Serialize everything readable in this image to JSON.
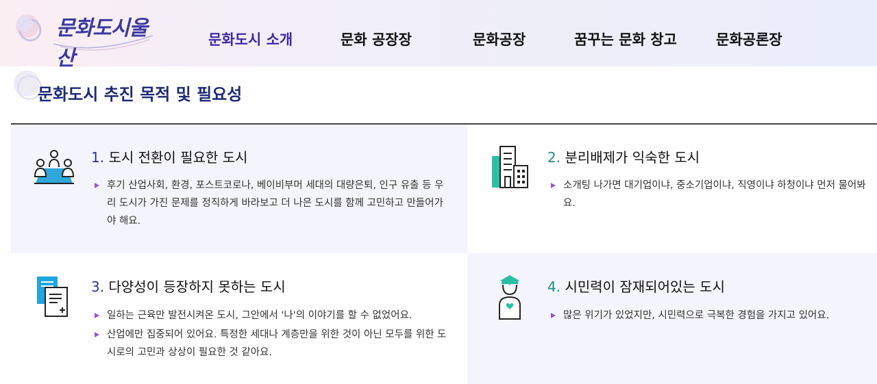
{
  "brand": {
    "logo_text": "문화도시울산"
  },
  "nav": {
    "items": [
      {
        "label": "문화도시 소개",
        "active": true
      },
      {
        "label": "문화 공장장",
        "active": false
      },
      {
        "label": "문화공장",
        "active": false
      },
      {
        "label": "꿈꾸는 문화 창고",
        "active": false
      },
      {
        "label": "문화공론장",
        "active": false
      }
    ]
  },
  "section": {
    "title": "문화도시 추진 목적 및 필요성"
  },
  "cards": [
    {
      "num": "1.",
      "title": "도시 전환이 필요한 도시",
      "icon": "meeting-people-icon",
      "bullets": [
        "후기 산업사회, 환경, 포스트코로나, 베이비부머 세대의 대량은퇴, 인구 유출 등 우리 도시가 가진 문제를 정직하게 바라보고 더 나은 도시를 함께 고민하고 만들어가야 해요."
      ]
    },
    {
      "num": "2.",
      "title": "분리배제가 익숙한 도시",
      "icon": "buildings-icon",
      "bullets": [
        "소개팅 나가면 대기업이냐, 중소기업이냐, 직영이냐 하청이냐 먼저 물어봐요."
      ]
    },
    {
      "num": "3.",
      "title": "다양성이 등장하지 못하는 도시",
      "icon": "documents-icon",
      "bullets": [
        "일하는 근육만 발전시켜온 도시, 그안에서 '나'의 이야기를 할 수 없었어요.",
        "산업에만 집중되어 있어요. 특정한 세대나 계층만을 위한 것이 아닌 모두를 위한 도시로의 고민과 상상이 필요한 것 같아요."
      ]
    },
    {
      "num": "4.",
      "title": "시민력이 잠재되어있는 도시",
      "icon": "citizen-heart-icon",
      "bullets": [
        "많은 위기가 있었지만, 시민력으로 극복한 경험을 가지고 있어요."
      ]
    }
  ],
  "colors": {
    "accent_purple": "#3d2aa7",
    "accent_teal": "#1d8c86",
    "highlight_pink": "#f6c7e4",
    "card_bg": "#f4f4fc"
  }
}
